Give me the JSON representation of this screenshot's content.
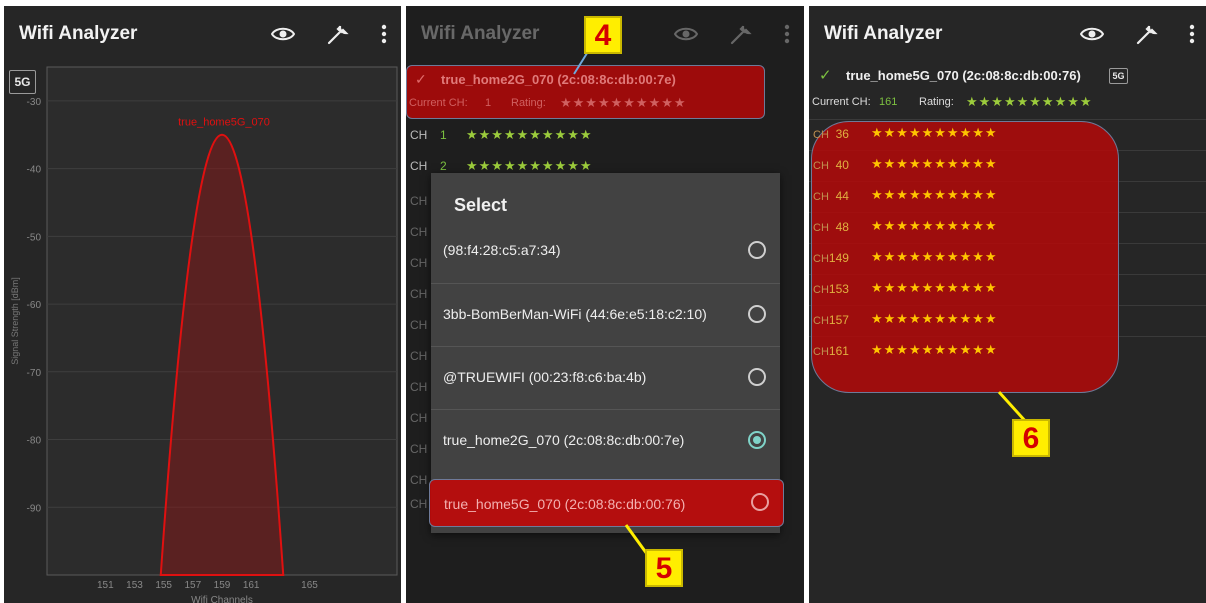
{
  "app": {
    "title": "Wifi Analyzer"
  },
  "icons": {
    "eye": "eye-icon",
    "wrench": "wrench-icon",
    "menu": "more-vert-icon",
    "check": "check-icon"
  },
  "panel1": {
    "band_chip": "5G",
    "network_label": "true_home5G_070",
    "chart_data": {
      "type": "area",
      "ylabel": "Signal Strength [dBm]",
      "xlabel": "Wifi Channels",
      "y_ticks": [
        "-30",
        "-40",
        "-50",
        "-60",
        "-70",
        "-80",
        "-90"
      ],
      "x_ticks": [
        "151",
        "153",
        "155",
        "157",
        "159",
        "161",
        "165"
      ],
      "ylim": [
        -100,
        -25
      ],
      "xlim": [
        147,
        171
      ],
      "series": [
        {
          "name": "true_home5G_070",
          "x": [
            154.8,
            159,
            163.2
          ],
          "y": [
            -100,
            -35,
            -100
          ],
          "color": "#e01010"
        }
      ]
    }
  },
  "panel2": {
    "connected": "true_home2G_070 (2c:08:8c:db:00:7e)",
    "current_ch_label": "Current CH:",
    "current_ch_value": "1",
    "rating_label": "Rating:",
    "rows": [
      {
        "ch": "CH",
        "num": "1",
        "stars": "★★★★★★★★★★"
      },
      {
        "ch": "CH",
        "num": "2",
        "stars": "★★★★★★★★★★"
      }
    ],
    "row_ch": "CH",
    "dialog": {
      "title": "Select",
      "options": [
        {
          "label": "(98:f4:28:c5:a7:34)",
          "selected": false
        },
        {
          "label": "3bb-BomBerMan-WiFi (44:6e:e5:18:c2:10)",
          "selected": false
        },
        {
          "label": "@TRUEWIFI (00:23:f8:c6:ba:4b)",
          "selected": false
        },
        {
          "label": "true_home2G_070 (2c:08:8c:db:00:7e)",
          "selected": true
        },
        {
          "label": "true_home5G_070 (2c:08:8c:db:00:76)",
          "selected": false
        }
      ]
    },
    "callouts": [
      "4",
      "5"
    ]
  },
  "panel3": {
    "connected": "true_home5G_070 (2c:08:8c:db:00:76)",
    "band_chip": "5G",
    "current_ch_label": "Current CH:",
    "current_ch_value": "161",
    "rating_label": "Rating:",
    "rating_stars": "★★★★★★★★★★",
    "channels": [
      {
        "ch": "CH",
        "num": "36",
        "stars": "★★★★★★★★★★"
      },
      {
        "ch": "CH",
        "num": "40",
        "stars": "★★★★★★★★★★"
      },
      {
        "ch": "CH",
        "num": "44",
        "stars": "★★★★★★★★★★"
      },
      {
        "ch": "CH",
        "num": "48",
        "stars": "★★★★★★★★★★"
      },
      {
        "ch": "CH",
        "num": "149",
        "stars": "★★★★★★★★★★"
      },
      {
        "ch": "CH",
        "num": "153",
        "stars": "★★★★★★★★★★"
      },
      {
        "ch": "CH",
        "num": "157",
        "stars": "★★★★★★★★★★"
      },
      {
        "ch": "CH",
        "num": "161",
        "stars": "★★★★★★★★★★"
      }
    ],
    "callout": "6"
  },
  "colors": {
    "highlight": "#b40808",
    "callout_bg": "#ffee00",
    "callout_text": "#d40000",
    "star_green": "#9ccc3c",
    "star_yellow": "#ffc400"
  }
}
